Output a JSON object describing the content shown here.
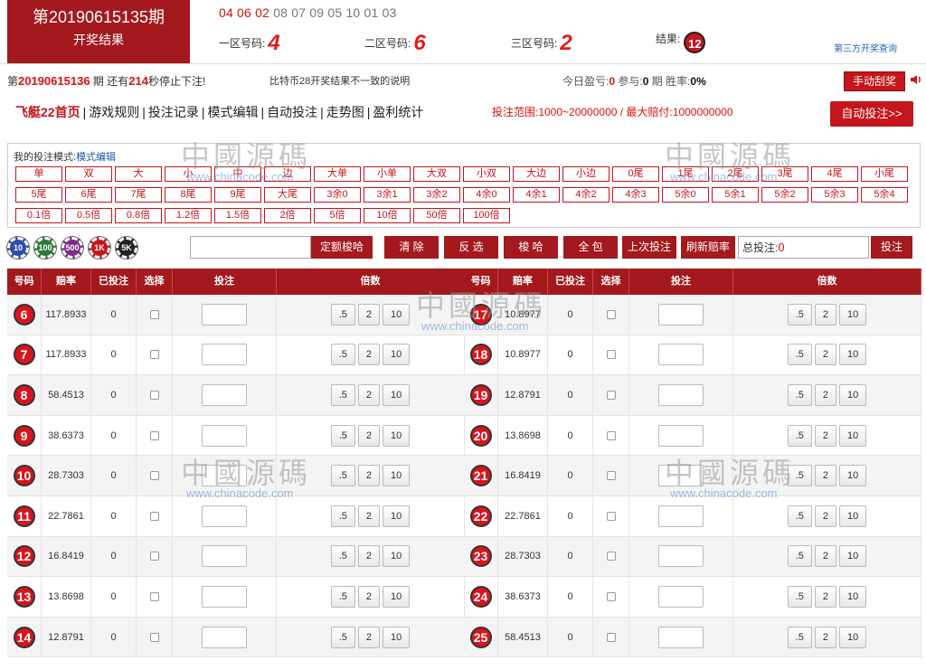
{
  "header": {
    "period_label": "第20190615135期",
    "period_subtitle": "开奖结果",
    "draw_numbers_highlight": "04 06 02",
    "draw_numbers_rest": " 08 07 09 05 10 01 03",
    "zone1_label": "一区号码:",
    "zone1_value": "4",
    "zone2_label": "二区号码:",
    "zone2_value": "6",
    "zone3_label": "三区号码:",
    "zone3_value": "2",
    "result_label": "结果:",
    "result_value": "12",
    "third_party_link": "第三方开奖查询"
  },
  "info": {
    "countdown_prefix": "第",
    "countdown_period": "20190615136",
    "countdown_mid": "期 还有",
    "countdown_seconds": "214",
    "countdown_suffix": "秒停止下注!",
    "notice": "比特币28开奖结果不一致的说明",
    "today_profit_label": "今日盈亏:",
    "today_profit": "0",
    "participate_label": "参与:",
    "participate": "0",
    "participate_unit": "期 胜率:",
    "win_rate": "0%",
    "manual_button": "手动刮奖"
  },
  "nav": {
    "items": [
      "飞艇22首页",
      "游戏规则",
      "投注记录",
      "模式编辑",
      "自动投注",
      "走势图",
      "盈利统计"
    ],
    "range_text": "投注范围:1000~20000000 / 最大赔付:1000000000",
    "auto_button": "自动投注>>"
  },
  "modes": {
    "title": "我的投注模式:",
    "edit_link": "模式编辑",
    "row1": [
      "单",
      "双",
      "大",
      "小",
      "中",
      "边",
      "大单",
      "小单",
      "大双",
      "小双",
      "大边",
      "小边",
      "0尾",
      "1尾",
      "2尾",
      "3尾",
      "4尾",
      "小尾"
    ],
    "row2": [
      "5尾",
      "6尾",
      "7尾",
      "8尾",
      "9尾",
      "大尾",
      "3余0",
      "3余1",
      "3余2",
      "4余0",
      "4余1",
      "4余2",
      "4余3",
      "5余0",
      "5余1",
      "5余2",
      "5余3",
      "5余4"
    ],
    "row3": [
      "0.1倍",
      "0.5倍",
      "0.8倍",
      "1.2倍",
      "1.5倍",
      "2倍",
      "5倍",
      "10倍",
      "50倍",
      "100倍"
    ]
  },
  "chips": [
    {
      "label": "10",
      "color": "#2d4fa8"
    },
    {
      "label": "100",
      "color": "#2b7a3a"
    },
    {
      "label": "500",
      "color": "#7b2e88"
    },
    {
      "label": "1K",
      "color": "#c4161c"
    },
    {
      "label": "5K",
      "color": "#222222"
    }
  ],
  "toolbar": {
    "fixed_button": "定额梭哈",
    "clear": "清 除",
    "invert": "反 选",
    "allin": "梭 哈",
    "all": "全 包",
    "last": "上次投注",
    "refresh": "刷新赔率",
    "total_label": "总投注:",
    "total_value": "0",
    "bet_button": "投注"
  },
  "table": {
    "headers": [
      "号码",
      "赔率",
      "已投注",
      "选择",
      "投注",
      "倍数"
    ],
    "multiplier_labels": [
      ".5",
      "2",
      "10"
    ],
    "left_rows": [
      {
        "num": "6",
        "odds": "117.8933",
        "bet": "0"
      },
      {
        "num": "7",
        "odds": "117.8933",
        "bet": "0"
      },
      {
        "num": "8",
        "odds": "58.4513",
        "bet": "0"
      },
      {
        "num": "9",
        "odds": "38.6373",
        "bet": "0"
      },
      {
        "num": "10",
        "odds": "28.7303",
        "bet": "0"
      },
      {
        "num": "11",
        "odds": "22.7861",
        "bet": "0"
      },
      {
        "num": "12",
        "odds": "16.8419",
        "bet": "0"
      },
      {
        "num": "13",
        "odds": "13.8698",
        "bet": "0"
      },
      {
        "num": "14",
        "odds": "12.8791",
        "bet": "0"
      }
    ],
    "right_rows": [
      {
        "num": "17",
        "odds": "10.8977",
        "bet": "0"
      },
      {
        "num": "18",
        "odds": "10.8977",
        "bet": "0"
      },
      {
        "num": "19",
        "odds": "12.8791",
        "bet": "0"
      },
      {
        "num": "20",
        "odds": "13.8698",
        "bet": "0"
      },
      {
        "num": "21",
        "odds": "16.8419",
        "bet": "0"
      },
      {
        "num": "22",
        "odds": "22.7861",
        "bet": "0"
      },
      {
        "num": "23",
        "odds": "28.7303",
        "bet": "0"
      },
      {
        "num": "24",
        "odds": "38.6373",
        "bet": "0"
      },
      {
        "num": "25",
        "odds": "58.4513",
        "bet": "0"
      }
    ]
  },
  "watermark": {
    "text": "中國源碼",
    "url": "www.chinacode.com"
  }
}
